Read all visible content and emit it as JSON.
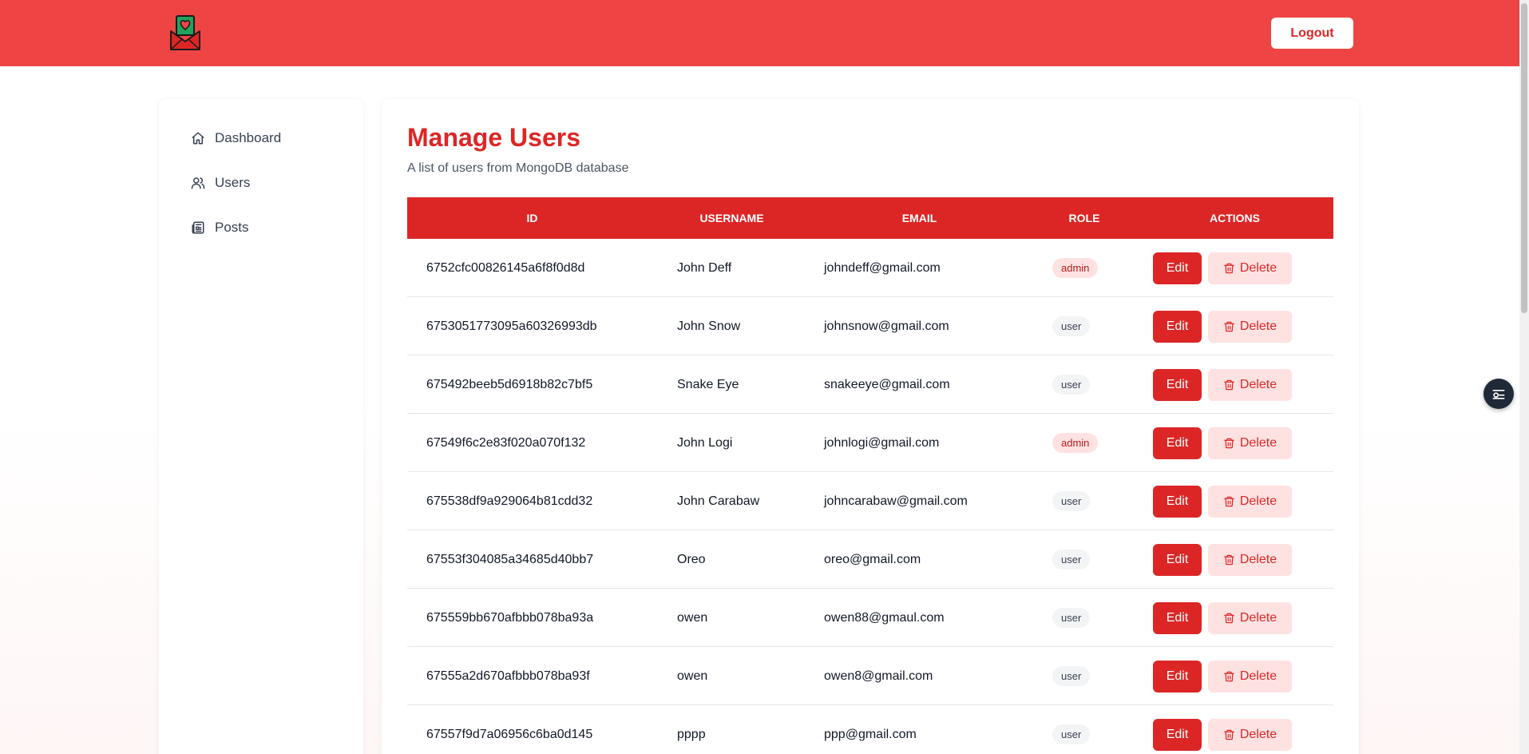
{
  "header": {
    "logout_label": "Logout",
    "accent_color": "#ef4444"
  },
  "sidebar": {
    "items": [
      {
        "label": "Dashboard",
        "icon": "home-icon"
      },
      {
        "label": "Users",
        "icon": "users-icon"
      },
      {
        "label": "Posts",
        "icon": "newspaper-icon"
      }
    ]
  },
  "main": {
    "title": "Manage Users",
    "subtitle": "A list of users from MongoDB database",
    "columns": [
      "ID",
      "USERNAME",
      "EMAIL",
      "ROLE",
      "ACTIONS"
    ],
    "edit_label": "Edit",
    "delete_label": "Delete",
    "rows": [
      {
        "id": "6752cfc00826145a6f8f0d8d",
        "username": "John Deff",
        "email": "johndeff@gmail.com",
        "role": "admin"
      },
      {
        "id": "6753051773095a60326993db",
        "username": "John Snow",
        "email": "johnsnow@gmail.com",
        "role": "user"
      },
      {
        "id": "675492beeb5d6918b82c7bf5",
        "username": "Snake Eye",
        "email": "snakeeye@gmail.com",
        "role": "user"
      },
      {
        "id": "67549f6c2e83f020a070f132",
        "username": "John Logi",
        "email": "johnlogi@gmail.com",
        "role": "admin"
      },
      {
        "id": "675538df9a929064b81cdd32",
        "username": "John Carabaw",
        "email": "johncarabaw@gmail.com",
        "role": "user"
      },
      {
        "id": "67553f304085a34685d40bb7",
        "username": "Oreo",
        "email": "oreo@gmail.com",
        "role": "user"
      },
      {
        "id": "675559bb670afbbb078ba93a",
        "username": "owen",
        "email": "owen88@gmaul.com",
        "role": "user"
      },
      {
        "id": "67555a2d670afbbb078ba93f",
        "username": "owen",
        "email": "owen8@gmail.com",
        "role": "user"
      },
      {
        "id": "67557f9d7a06956c6ba0d145",
        "username": "pppp",
        "email": "ppp@gmail.com",
        "role": "user"
      }
    ]
  },
  "colors": {
    "primary": "#dc2626",
    "admin_badge_bg": "#fee2e2",
    "user_badge_bg": "#f3f4f6"
  }
}
